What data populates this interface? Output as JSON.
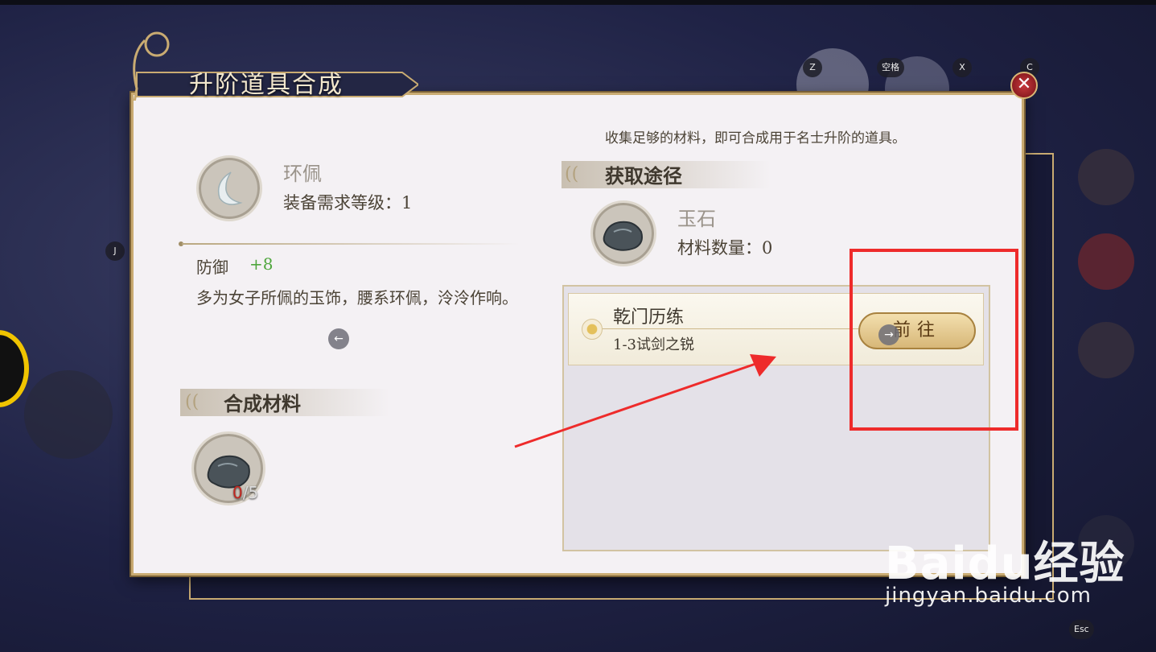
{
  "keys": {
    "z": "Z",
    "space": "空格",
    "x": "X",
    "c": "C",
    "j": "J",
    "esc": "Esc"
  },
  "title": "升阶道具合成",
  "close_glyph": "✕",
  "hint": "收集足够的材料，即可合成用于名士升阶的道具。",
  "item": {
    "name": "环佩",
    "requirement": "装备需求等级：1",
    "stat_label": "防御",
    "stat_value": "+8",
    "description": "多为女子所佩的玉饰，腰系环佩，泠泠作响。"
  },
  "nav_left": "←",
  "nav_right": "→",
  "materials_section": "合成材料",
  "material_count": {
    "have": "0",
    "need": "/5"
  },
  "sources_section": "获取途径",
  "source_item": {
    "name": "玉石",
    "quantity": "材料数量：0"
  },
  "source_rows": [
    {
      "title": "乾门历练",
      "subtitle": "1-3试剑之锐",
      "button": "前往"
    }
  ],
  "watermark": {
    "logo": "Baidu经验",
    "url": "jingyan.baidu.com"
  },
  "colors": {
    "highlight": "#ee2b2b",
    "arrow": "#ee2b2b",
    "stat_green": "#4fa63d",
    "count_red": "#c3261f"
  }
}
